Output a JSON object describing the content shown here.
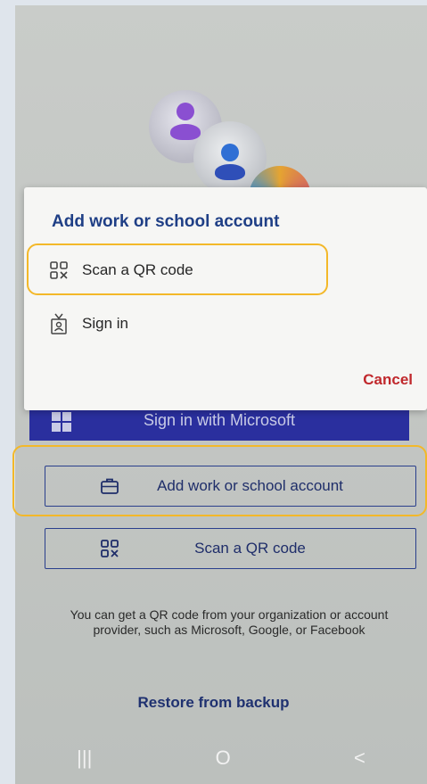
{
  "dialog": {
    "title": "Add work or school account",
    "option_qr": "Scan a QR code",
    "option_signin": "Sign in",
    "cancel": "Cancel"
  },
  "buttons": {
    "microsoft": "Sign in with Microsoft",
    "add_account": "Add work or school account",
    "scan_qr": "Scan a QR code"
  },
  "helper_text": "You can get a QR code from your organization or account provider, such as Microsoft, Google, or Facebook",
  "restore": "Restore from backup",
  "nav": {
    "recents": "|||",
    "home": "O",
    "back": "<"
  },
  "icons": [
    "qr-code-icon",
    "badge-icon",
    "briefcase-icon",
    "microsoft-logo",
    "recents-icon",
    "home-icon",
    "back-icon"
  ],
  "colors": {
    "accent": "#2a2f9e",
    "cancel": "#c0282c",
    "highlight": "#f3b829",
    "title": "#1f3f86"
  }
}
